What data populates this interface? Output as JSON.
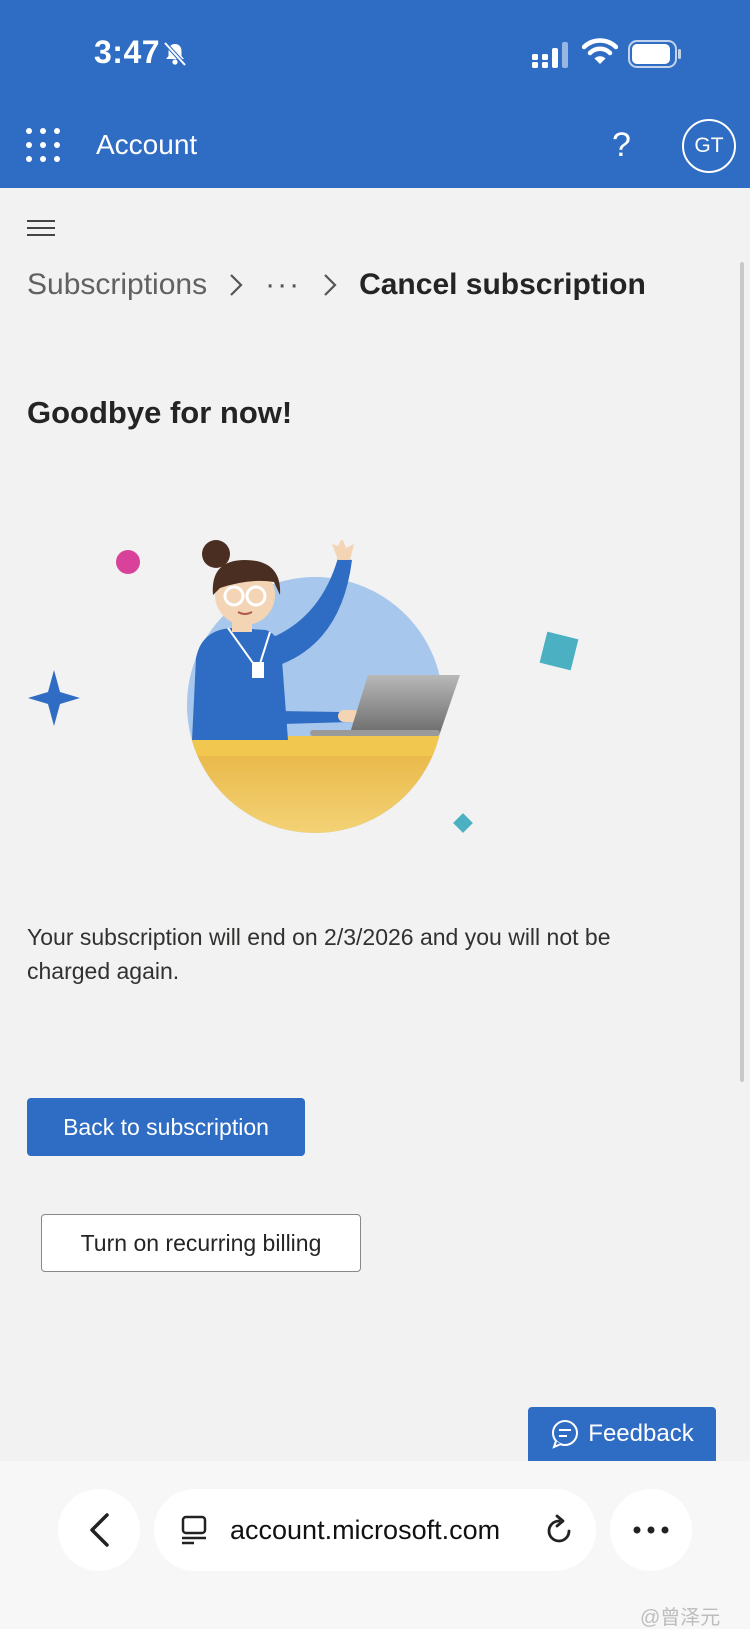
{
  "status_bar": {
    "time": "3:47"
  },
  "header": {
    "title": "Account",
    "help_symbol": "?",
    "avatar_initials": "GT",
    "accent_color": "#2f6cc4"
  },
  "breadcrumb": {
    "first": "Subscriptions",
    "ellipsis": "···",
    "current": "Cancel subscription"
  },
  "page": {
    "heading": "Goodbye for now!",
    "message": "Your subscription will end on 2/3/2026 and you will not be charged again.",
    "primary_button": "Back to subscription",
    "secondary_button": "Turn on recurring billing"
  },
  "feedback": {
    "label": "Feedback"
  },
  "browser": {
    "url": "account.microsoft.com"
  },
  "watermark": "@曾泽元",
  "icons": [
    "bell-slash-icon",
    "cellular-signal-icon",
    "wifi-icon",
    "battery-icon",
    "app-launcher-icon",
    "help-icon",
    "hamburger-menu-icon",
    "chevron-right-icon",
    "chat-bubble-icon",
    "back-arrow-icon",
    "tabs-icon",
    "reload-icon",
    "more-icon"
  ]
}
